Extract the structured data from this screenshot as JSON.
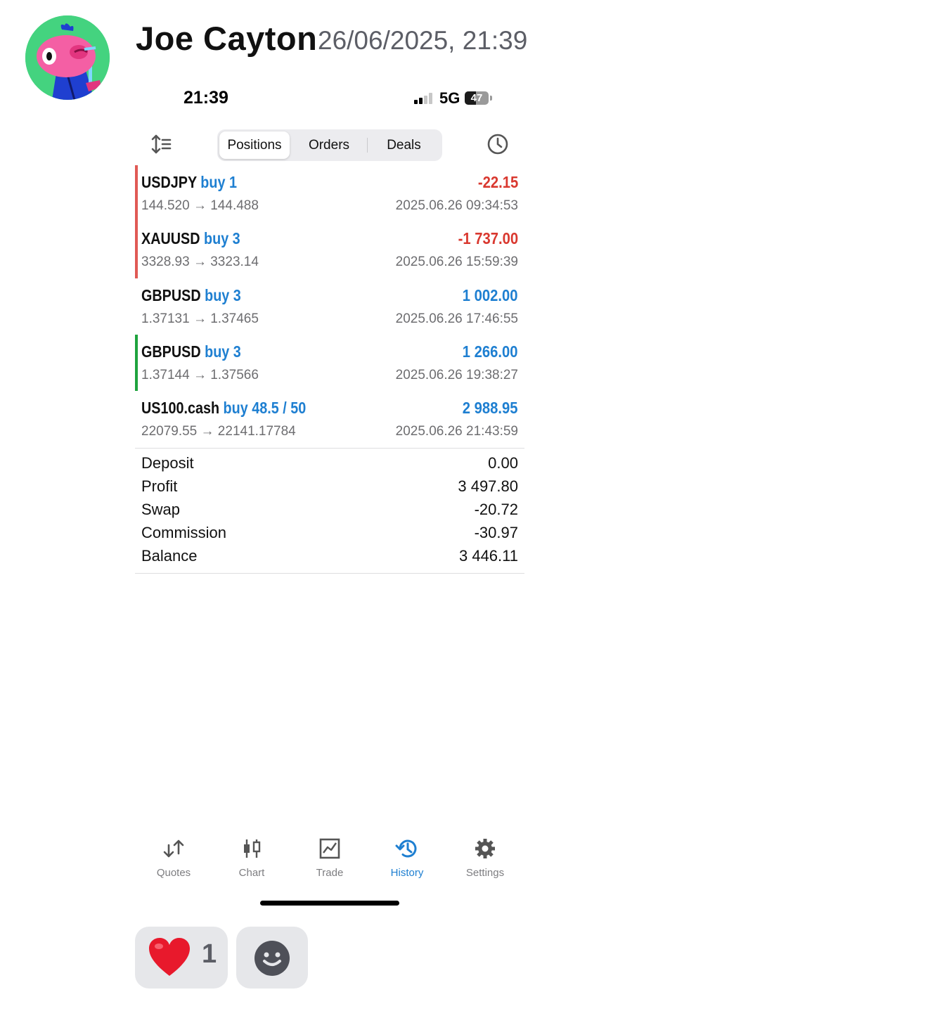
{
  "message": {
    "author": "Joe Cayton",
    "timestamp": "26/06/2025, 21:39",
    "avatar_icon": "cartoon-bird-avatar-icon"
  },
  "phone": {
    "status_bar": {
      "time": "21:39",
      "network": "5G",
      "battery": "47"
    },
    "toolbar": {
      "tabs": [
        {
          "label": "Positions",
          "active": true
        },
        {
          "label": "Orders",
          "active": false
        },
        {
          "label": "Deals",
          "active": false
        }
      ]
    },
    "positions": [
      {
        "symbol": "USDJPY",
        "side": "buy 1",
        "profit": "-22.15",
        "prices": "144.520 → 144.488",
        "datetime": "2025.06.26 09:34:53"
      },
      {
        "symbol": "XAUUSD",
        "side": "buy 3",
        "profit": "-1 737.00",
        "prices": "3328.93 → 3323.14",
        "datetime": "2025.06.26 15:59:39"
      },
      {
        "symbol": "GBPUSD",
        "side": "buy 3",
        "profit": "1 002.00",
        "prices": "1.37131 → 1.37465",
        "datetime": "2025.06.26 17:46:55"
      },
      {
        "symbol": "GBPUSD",
        "side": "buy 3",
        "profit": "1 266.00",
        "prices": "1.37144 → 1.37566",
        "datetime": "2025.06.26 19:38:27"
      },
      {
        "symbol": "US100.cash",
        "side": "buy 48.5 / 50",
        "profit": "2 988.95",
        "prices": "22079.55 → 22141.17784",
        "datetime": "2025.06.26 21:43:59"
      }
    ],
    "summary": [
      {
        "label": "Deposit",
        "value": "0.00"
      },
      {
        "label": "Profit",
        "value": "3 497.80"
      },
      {
        "label": "Swap",
        "value": "-20.72"
      },
      {
        "label": "Commission",
        "value": "-30.97"
      },
      {
        "label": "Balance",
        "value": "3 446.11"
      }
    ],
    "tabbar": [
      {
        "label": "Quotes",
        "icon": "quotes-arrows-icon",
        "active": false
      },
      {
        "label": "Chart",
        "icon": "candlestick-chart-icon",
        "active": false
      },
      {
        "label": "Trade",
        "icon": "trade-chart-icon",
        "active": false
      },
      {
        "label": "History",
        "icon": "history-clock-icon",
        "active": true
      },
      {
        "label": "Settings",
        "icon": "gear-icon",
        "active": false
      }
    ]
  },
  "reactions": [
    {
      "emoji": "heart-emoji-icon",
      "count": "1"
    },
    {
      "emoji": "add-reaction-smiley-icon"
    }
  ],
  "colors": {
    "loss": "#d9382f",
    "gain": "#1e7fd1",
    "marker_red": "#e05a55",
    "marker_green": "#1fa33e",
    "avatar_bg": "#44d37f",
    "reaction_bg": "#e6e7ea"
  }
}
